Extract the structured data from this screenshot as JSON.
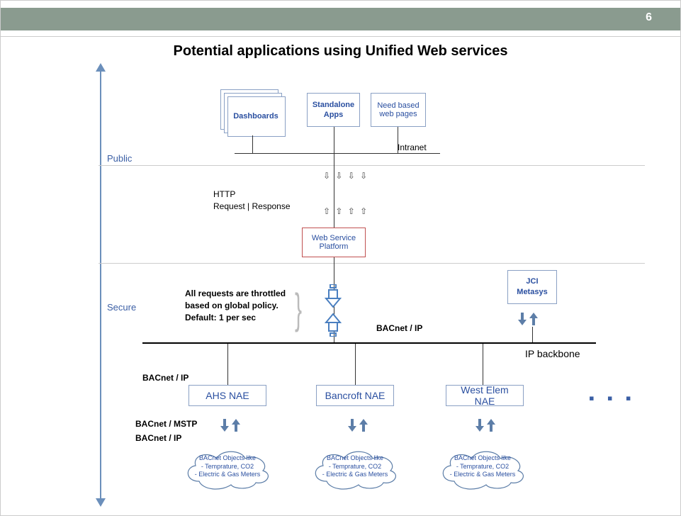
{
  "page_number": "6",
  "title": "Potential applications using Unified Web services",
  "axis": {
    "public": "Public",
    "secure": "Secure"
  },
  "top": {
    "dashboards": "Dashboards",
    "standalone": "Standalone Apps",
    "needbased": "Need based web pages",
    "intranet": "Intranet"
  },
  "http": {
    "label": "HTTP\nRequest | Response",
    "arrows_down": "⇩ ⇩ ⇩ ⇩",
    "arrows_up": "⇧ ⇧ ⇧ ⇧"
  },
  "wsp": "Web Service Platform",
  "throttle": "All requests are throttled based on global policy.\nDefault:  1 per sec",
  "bacnet_ip": "BACnet / IP",
  "jci": "JCI\nMetasys",
  "backbone": "IP backbone",
  "nae": {
    "ahs": "AHS    NAE",
    "bancroft": "Bancroft NAE",
    "westelem": "West Elem NAE"
  },
  "dots": "▪ ▪ ▪",
  "bacnet_mstp": "BACnet / MSTP",
  "cloud": {
    "line1": "BACnet Objects like",
    "line2": "- Temprature, CO2",
    "line3": "- Electric & Gas Meters"
  }
}
